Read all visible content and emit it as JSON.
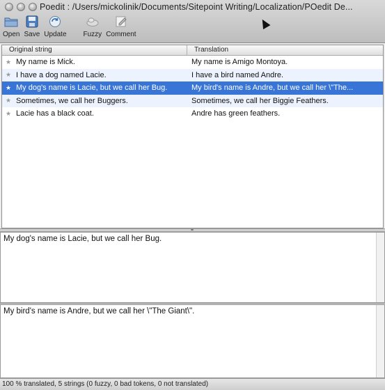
{
  "window": {
    "title": "Poedit : /Users/mickolinik/Documents/Sitepoint Writing/Localization/POedit De..."
  },
  "toolbar": {
    "open": "Open",
    "save": "Save",
    "update": "Update",
    "fuzzy": "Fuzzy",
    "comment": "Comment"
  },
  "table": {
    "headers": {
      "original": "Original string",
      "translation": "Translation"
    },
    "rows": [
      {
        "original": "My name is Mick.",
        "translation": "My name is Amigo Montoya."
      },
      {
        "original": "I have a dog named Lacie.",
        "translation": "I have a bird named Andre."
      },
      {
        "original": "My dog's name is Lacie, but we call her Bug.",
        "translation": "My bird's name is Andre, but we call her \\\"The..."
      },
      {
        "original": "Sometimes, we call her Buggers.",
        "translation": "Sometimes, we call her Biggie Feathers."
      },
      {
        "original": "Lacie has a black coat.",
        "translation": "Andre has green feathers."
      }
    ],
    "selected_index": 2
  },
  "source_pane": {
    "text": "My dog's name is Lacie, but we call her Bug."
  },
  "translation_pane": {
    "text": "My bird's name is Andre, but we call her \\\"The Giant\\\"."
  },
  "status": {
    "text": "100 % translated, 5 strings (0 fuzzy, 0 bad tokens, 0 not translated)"
  },
  "icons": {
    "open": "folder-icon",
    "save": "save-icon",
    "update": "update-icon",
    "fuzzy": "fuzzy-icon",
    "comment": "comment-icon",
    "row_marker": "star-icon"
  },
  "colors": {
    "selection": "#3875d7",
    "alt_row": "#edf3fe"
  }
}
